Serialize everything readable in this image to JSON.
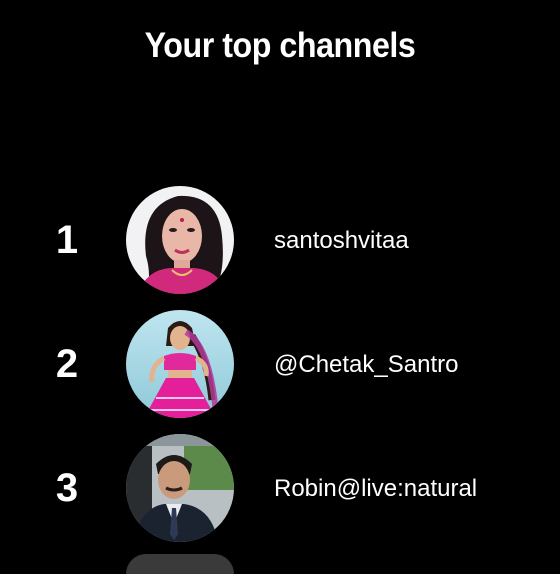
{
  "header": {
    "title": "Your top channels"
  },
  "channels": [
    {
      "rank": "1",
      "name": "santoshvitaa",
      "avatar": "avatar-woman-portrait"
    },
    {
      "rank": "2",
      "name": "@Chetak_Santro",
      "avatar": "avatar-dancer-illustration"
    },
    {
      "rank": "3",
      "name": "Robin@live:natural",
      "avatar": "avatar-man-in-car"
    }
  ],
  "colors": {
    "background": "#000000",
    "text": "#ffffff"
  }
}
